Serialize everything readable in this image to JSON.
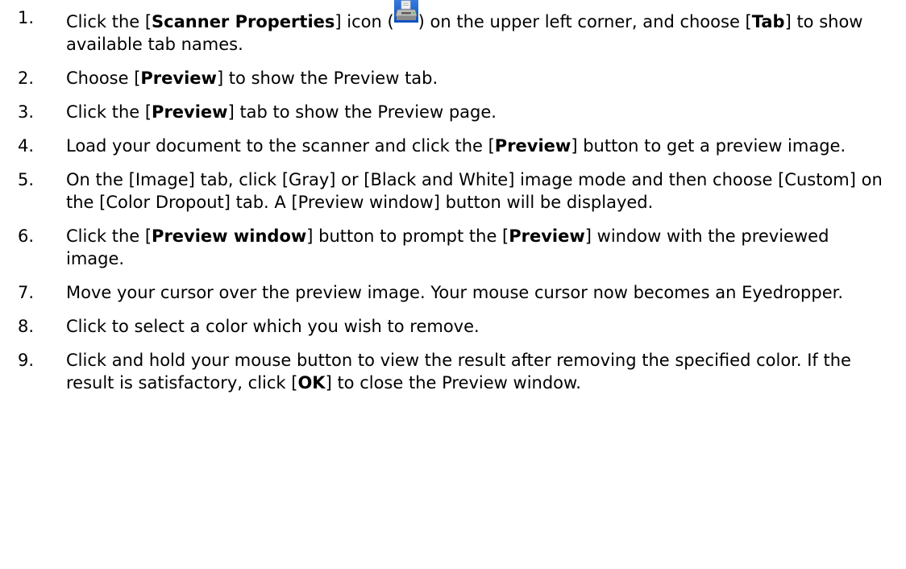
{
  "steps": [
    {
      "num": "1.",
      "segments": [
        {
          "t": "Click the ["
        },
        {
          "t": "Scanner Properties",
          "b": true
        },
        {
          "t": "] icon ("
        },
        {
          "icon": "scanner-properties-icon"
        },
        {
          "t": ") on the upper left corner, and choose ["
        },
        {
          "t": "Tab",
          "b": true
        },
        {
          "t": "] to show available tab names."
        }
      ]
    },
    {
      "num": "2.",
      "segments": [
        {
          "t": "Choose ["
        },
        {
          "t": "Preview",
          "b": true
        },
        {
          "t": "] to show the Preview tab."
        }
      ]
    },
    {
      "num": "3.",
      "segments": [
        {
          "t": "Click the ["
        },
        {
          "t": "Preview",
          "b": true
        },
        {
          "t": "] tab to show the Preview page."
        }
      ]
    },
    {
      "num": "4.",
      "segments": [
        {
          "t": "Load your document to the scanner and click the ["
        },
        {
          "t": "Preview",
          "b": true
        },
        {
          "t": "] button to get a preview image."
        }
      ]
    },
    {
      "num": "5.",
      "segments": [
        {
          "t": "On the [Image] tab, click [Gray] or [Black and White] image mode and then choose [Custom] on the [Color Dropout] tab. A [Preview window] button will be displayed."
        }
      ]
    },
    {
      "num": "6.",
      "segments": [
        {
          "t": "Click the ["
        },
        {
          "t": "Preview window",
          "b": true
        },
        {
          "t": "] button to prompt the ["
        },
        {
          "t": "Preview",
          "b": true
        },
        {
          "t": "] window with the previewed image."
        }
      ]
    },
    {
      "num": "7.",
      "segments": [
        {
          "t": "Move your cursor over the preview image. Your mouse cursor now becomes an Eyedropper."
        }
      ]
    },
    {
      "num": "8.",
      "segments": [
        {
          "t": "Click to select a color which you wish to remove."
        }
      ]
    },
    {
      "num": "9.",
      "segments": [
        {
          "t": "Click and hold your mouse button to view the result after removing the specified color.   If the result is satisfactory, click ["
        },
        {
          "t": "OK",
          "b": true
        },
        {
          "t": "] to close the Preview window."
        }
      ]
    }
  ]
}
